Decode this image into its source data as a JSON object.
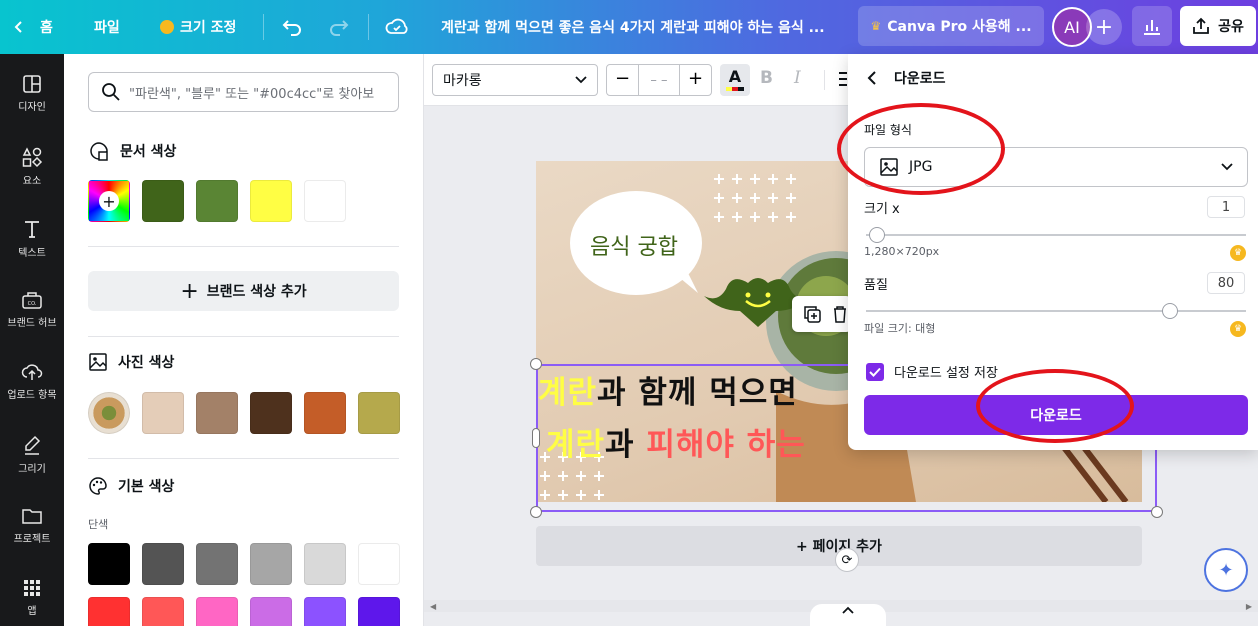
{
  "topbar": {
    "home": "홈",
    "file": "파일",
    "resize": "크기 조정",
    "doc_title": "계란과 함께 먹으면 좋은 음식 4가지 계란과 피해야 하는 음식 ...",
    "pro": "Canva Pro 사용해 ...",
    "avatar": "AI",
    "share": "공유"
  },
  "rail": {
    "items": [
      {
        "label": "디자인",
        "icon": "layout-icon"
      },
      {
        "label": "요소",
        "icon": "shapes-icon"
      },
      {
        "label": "텍스트",
        "icon": "text-icon"
      },
      {
        "label": "브랜드 허브",
        "icon": "brand-icon"
      },
      {
        "label": "업로드 항목",
        "icon": "upload-icon"
      },
      {
        "label": "그리기",
        "icon": "draw-icon"
      },
      {
        "label": "프로젝트",
        "icon": "folder-icon"
      },
      {
        "label": "앱",
        "icon": "apps-icon"
      }
    ]
  },
  "panel": {
    "search_placeholder": "\"파란색\", \"블루\" 또는 \"#00c4cc\"로 찾아보",
    "doc_colors_title": "문서 색상",
    "doc_colors": [
      "#40641a",
      "#5a8534",
      "#fffe44",
      "#ffffff"
    ],
    "brand_btn": "브랜드 색상 추가",
    "photo_colors_title": "사진 색상",
    "photo_colors": [
      "#e4cdb8",
      "#a38168",
      "#4e311d",
      "#c45d28",
      "#b5a94c"
    ],
    "basic_colors_title": "기본 색상",
    "solid_label": "단색",
    "basic_row1": [
      "#000000",
      "#545454",
      "#737373",
      "#a6a6a6",
      "#d9d9d9",
      "#ffffff"
    ],
    "basic_row2": [
      "#ff3131",
      "#ff5757",
      "#ff66c4",
      "#cb6ce6",
      "#8c52ff",
      "#5e17eb"
    ]
  },
  "toolbar": {
    "font": "마카롱",
    "size_placeholder": "– –"
  },
  "design": {
    "bubble": "음식 궁합",
    "line1_a": "계란",
    "line1_b": "과 함께 먹으면",
    "line2_a": "계란",
    "line2_b": "과 ",
    "line2_c": "피해야 하는",
    "add_page": "+ 페이지 추가"
  },
  "download": {
    "title": "다운로드",
    "file_type_label": "파일 형식",
    "file_type": "JPG",
    "size_label": "크기 x",
    "size_value": "1",
    "size_fraction": 0.03,
    "dimensions": "1,280×720px",
    "quality_label": "품질",
    "quality_value": "80",
    "quality_fraction": 0.8,
    "file_size": "파일 크기: 대형",
    "save_settings": "다운로드 설정 저장",
    "download_btn": "다운로드"
  },
  "colors": {
    "accent": "#7d2ae8",
    "annotation": "#e3141b"
  }
}
